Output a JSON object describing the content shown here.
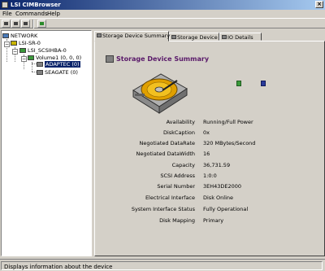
{
  "window": {
    "title": "LSI CIMBrowser"
  },
  "menu": {
    "items": [
      "File",
      "Commands",
      "Help"
    ]
  },
  "tree": {
    "nodes": [
      {
        "label": "NETWORK"
      },
      {
        "label": "LSI-SR-0"
      },
      {
        "label": "LSI_SCSIHBA-0"
      },
      {
        "label": "Volume1 (0, 0, 0)"
      },
      {
        "label": "ADAPTEC (0)"
      },
      {
        "label": "SEAGATE (0)"
      }
    ]
  },
  "tabs": [
    "Storage Device Summary",
    "Storage Device",
    "IO Details"
  ],
  "panel": {
    "heading": "Storage Device Summary",
    "properties": [
      {
        "label": "Availability",
        "value": "Running/Full Power"
      },
      {
        "label": "DiskCaption",
        "value": "0x"
      },
      {
        "label": "Negotiated DataRate",
        "value": "320 MBytes/Second"
      },
      {
        "label": "Negotiated DataWidth",
        "value": "16"
      },
      {
        "label": "Capacity",
        "value": "36,731.59"
      },
      {
        "label": "SCSI Address",
        "value": "1:0:0"
      },
      {
        "label": "Serial Number",
        "value": "3EH43DE2000"
      },
      {
        "label": "Electrical Interface",
        "value": "Disk Online"
      },
      {
        "label": "System Interface Status",
        "value": "Fully Operational"
      },
      {
        "label": "Disk Mapping",
        "value": "Primary"
      }
    ]
  },
  "status": {
    "text": "Displays information about the device"
  },
  "colors": {
    "titlebar": "#0a246a",
    "heading": "#5a1a6a",
    "selection": "#0a246a"
  },
  "icons": [
    "app-icon",
    "close-icon",
    "toolbar-icon",
    "folder-icon",
    "drive-icon",
    "hard-disk-icon"
  ]
}
